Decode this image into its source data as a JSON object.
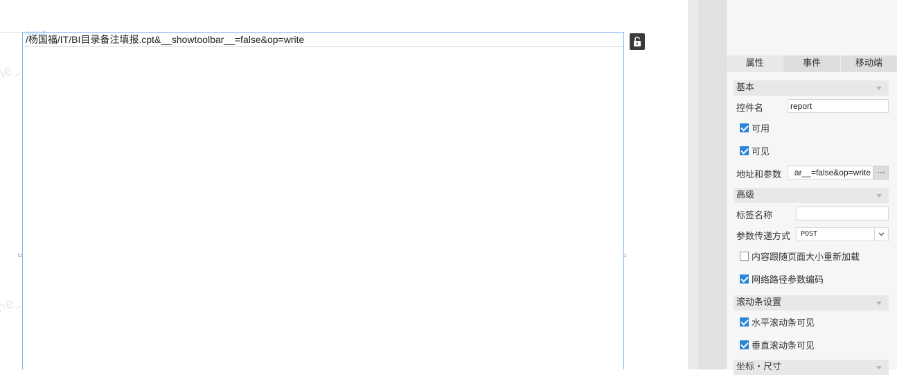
{
  "canvas": {
    "widget_tag": "report",
    "url_text": "/杨国福/IT/BI目录备注填报.cpt&__showtoolbar__=false&op=write",
    "watermark": "me_"
  },
  "panel": {
    "tabs": [
      {
        "label": "属性",
        "active": true
      },
      {
        "label": "事件",
        "active": false
      },
      {
        "label": "移动端",
        "active": false
      }
    ],
    "basic": {
      "title": "基本",
      "widget_name_label": "控件名",
      "widget_name_value": "report",
      "enabled": {
        "label": "可用",
        "checked": true
      },
      "visible": {
        "label": "可见",
        "checked": true
      },
      "url_label": "地址和参数",
      "url_value": "ar__=false&op=write",
      "url_button": "···"
    },
    "advanced": {
      "title": "高级",
      "tag_name_label": "标签名称",
      "tag_name_value": "",
      "method_label": "参数传递方式",
      "method_value": "POST",
      "reload": {
        "label": "内容跟随页面大小重新加载",
        "checked": false
      },
      "encode": {
        "label": "网络路径参数编码",
        "checked": true
      }
    },
    "scroll": {
      "title": "滚动条设置",
      "horizontal": {
        "label": "水平滚动条可见",
        "checked": true
      },
      "vertical": {
        "label": "垂直滚动条可见",
        "checked": true
      }
    },
    "position": {
      "title": "坐标・尺寸"
    }
  },
  "colors": {
    "selection_border": "#7fb6f1",
    "checkbox_checked": "#2c86d8",
    "lock_button": "#3a3a3a"
  }
}
